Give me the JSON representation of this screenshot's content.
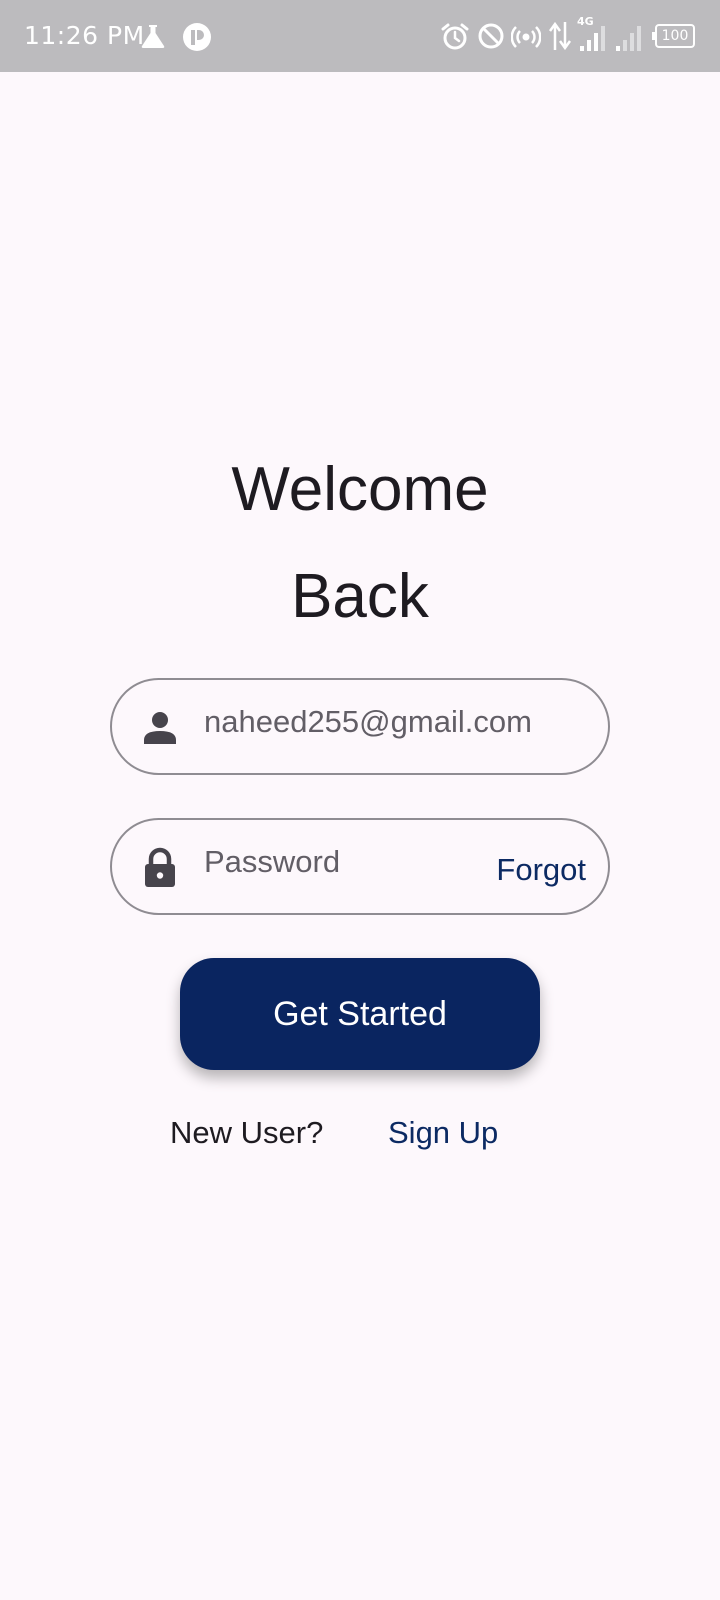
{
  "status_bar": {
    "time": "11:26 PM",
    "network_type": "4G",
    "battery_level": "100",
    "icons": [
      "flask-icon",
      "app-badge-icon",
      "alarm-icon",
      "do-not-disturb-icon",
      "hotspot-icon",
      "data-arrows-icon",
      "signal-icon",
      "signal-icon",
      "battery-icon"
    ]
  },
  "login": {
    "title_line1": "Welcome",
    "title_line2": "Back",
    "email_value": "naheed255@gmail.com",
    "email_icon": "person-icon",
    "password_placeholder": "Password",
    "password_icon": "lock-icon",
    "forgot_label": "Forgot",
    "submit_label": "Get Started",
    "new_user_label": "New User?",
    "signup_label": "Sign Up"
  },
  "colors": {
    "background": "#fdf8fc",
    "status_bar": "#bcbbbe",
    "primary_button": "#0a2560",
    "link": "#0c2a63",
    "text": "#1e1b21",
    "field_border": "#8f8c92",
    "field_text": "#625e66"
  }
}
